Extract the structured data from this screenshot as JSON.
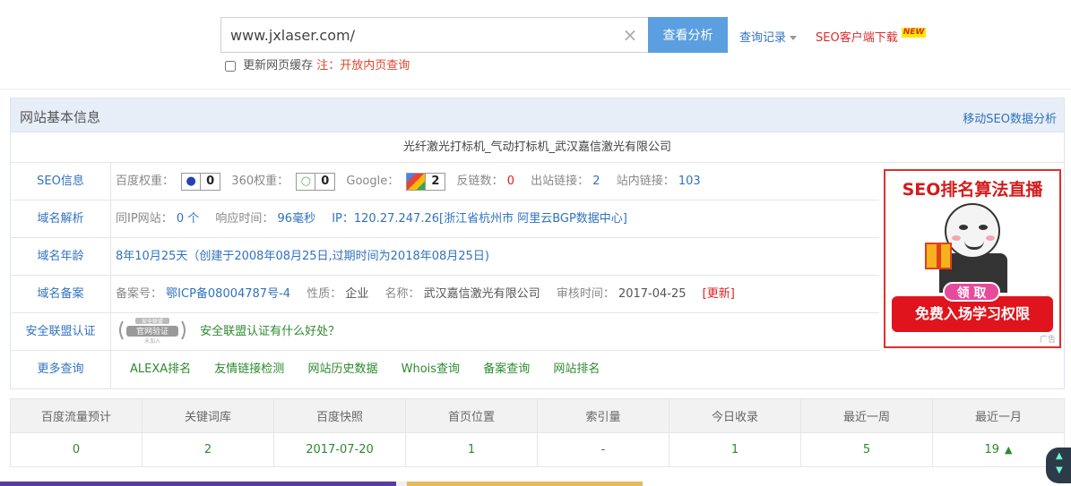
{
  "search": {
    "value": "www.jxlaser.com/",
    "button_label": "查看分析",
    "history_label": "查询记录",
    "client_label": "SEO客户端下载",
    "new_badge": "NEW",
    "cache_label": "更新网页缓存",
    "cache_note": "注：开放内页查询"
  },
  "panel": {
    "title": "网站基本信息",
    "mobile_link": "移动SEO数据分析",
    "site_title": "光纤激光打标机_气动打标机_武汉嘉信激光有限公司",
    "seo": {
      "label": "SEO信息",
      "baidu_label": "百度权重：",
      "baidu_value": "0",
      "s360_label": "360权重：",
      "s360_value": "0",
      "google_label": "Google：",
      "google_value": "2",
      "backlinks_label": "反链数：",
      "backlinks_value": "0",
      "outlinks_label": "出站链接：",
      "outlinks_value": "2",
      "inlinks_label": "站内链接：",
      "inlinks_value": "103"
    },
    "domain": {
      "label": "域名解析",
      "sameip_label": "同IP网站：",
      "sameip_value": "0 个",
      "response_label": "响应时间：",
      "response_value": "96毫秒",
      "ip_text": "IP：120.27.247.26[浙江省杭州市 阿里云BGP数据中心]"
    },
    "age": {
      "label": "域名年龄",
      "text": "8年10月25天（创建于2008年08月25日,过期时间为2018年08月25日)"
    },
    "icp": {
      "label": "域名备案",
      "number_label": "备案号：",
      "number_value": "鄂ICP备08004787号-4",
      "nature_label": "性质：",
      "nature_value": "企业",
      "name_label": "名称：",
      "name_value": "武汉嘉信激光有限公司",
      "review_label": "审核时间：",
      "review_value": "2017-04-25",
      "update_label": "[更新]"
    },
    "security": {
      "label": "安全联盟认证",
      "badge_top": "安全联盟",
      "badge_mid": "官网验证",
      "badge_bottom": "未加入",
      "link": "安全联盟认证有什么好处？"
    },
    "more": {
      "label": "更多查询",
      "links": [
        "ALEXA排名",
        "友情链接检测",
        "网站历史数据",
        "Whois查询",
        "备案查询",
        "网站排名"
      ]
    }
  },
  "ad": {
    "title": "SEO排名算法直播",
    "claim": "领 取",
    "bottom": "免费入场学习权限",
    "tag": "广告"
  },
  "stats": {
    "headers": [
      "百度流量预计",
      "关键词库",
      "百度快照",
      "首页位置",
      "索引量",
      "今日收录",
      "最近一周",
      "最近一月"
    ],
    "values": [
      "0",
      "2",
      "2017-07-20",
      "1",
      "-",
      "1",
      "5",
      "19"
    ]
  }
}
